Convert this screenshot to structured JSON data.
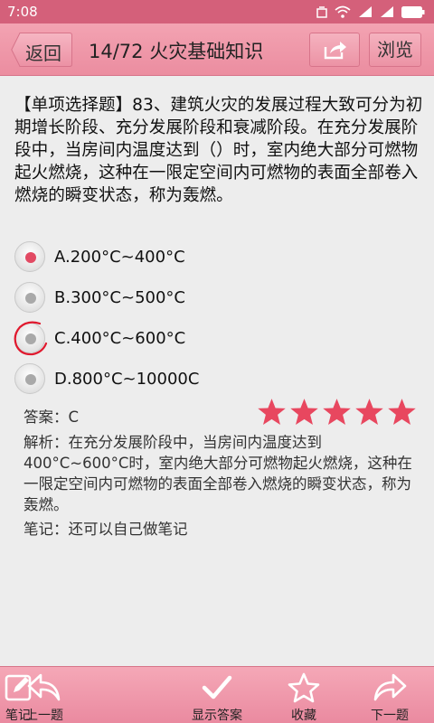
{
  "status_bar": {
    "time": "7:08"
  },
  "header": {
    "back_label": "返回",
    "title": "14/72 火灾基础知识",
    "browse_label": "浏览"
  },
  "question": {
    "text": "【单项选择题】83、建筑火灾的发展过程大致可分为初期增长阶段、充分发展阶段和衰减阶段。在充分发展阶段中，当房间内温度达到（）时，室内绝大部分可燃物起火燃烧，这种在一限定空间内可燃物的表面全部卷入燃烧的瞬变状态，称为轰燃。",
    "options": [
      {
        "label": "A.200°C~400°C",
        "selected": true
      },
      {
        "label": "B.300°C~500°C",
        "selected": false
      },
      {
        "label": "C.400°C~600°C",
        "selected": false
      },
      {
        "label": "D.800°C~10000C",
        "selected": false
      }
    ]
  },
  "answer": {
    "text": "答案：C",
    "rating": 5,
    "rating_max": 5,
    "star_color": "#e8475f"
  },
  "explanation": "解析：在充分发展阶段中，当房间内温度达到400°C~600°C时，室内绝大部分可燃物起火燃烧，这种在一限定空间内可燃物的表面全部卷入燃烧的瞬变状态，称为轰燃。",
  "note": "笔记：还可以自己做笔记",
  "bottom_nav": {
    "prev": {
      "label": "上一题",
      "icon": "back-arrow-icon"
    },
    "note": {
      "label": "笔记",
      "icon": "edit-icon"
    },
    "show_answer": {
      "label": "显示答案",
      "icon": "check-icon"
    },
    "favorite": {
      "label": "收藏",
      "icon": "star-outline-icon"
    },
    "next": {
      "label": "下一题",
      "icon": "forward-arrow-icon"
    }
  },
  "colors": {
    "accent": "#eb8da0",
    "status_bar": "#d4607a",
    "selected_radio": "#e24a63"
  }
}
